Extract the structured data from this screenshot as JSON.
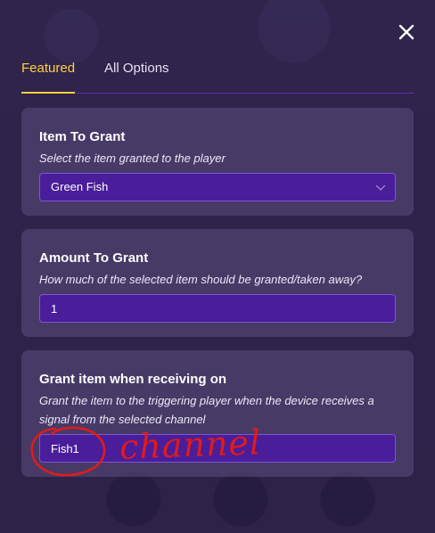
{
  "dialog": {
    "close_icon": "close-icon"
  },
  "tabs": {
    "featured": "Featured",
    "all_options": "All Options",
    "active_color": "#ffd23a"
  },
  "settings": [
    {
      "title": "Item To Grant",
      "description": "Select the item granted to the player",
      "value": "Green Fish",
      "control": "select",
      "icon": "chevron-down-icon"
    },
    {
      "title": "Amount To Grant",
      "description": "How much of the selected item should be granted/taken away?",
      "value": "1",
      "control": "input"
    },
    {
      "title": "Grant item when receiving on",
      "description": "Grant the item to the triggering player when the device receives a signal from the selected channel",
      "value": "Fish1",
      "control": "input"
    }
  ],
  "annotation": {
    "text": "channel",
    "color": "#e01b1b"
  },
  "colors": {
    "field_bg": "#4a1d9a",
    "tab_underline": "#5a2fb8"
  }
}
